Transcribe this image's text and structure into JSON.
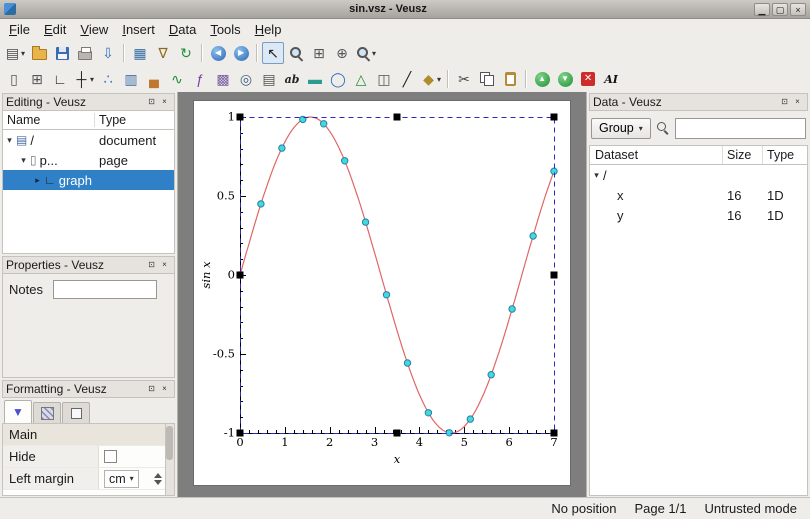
{
  "colors": {
    "accent": "#3080c8",
    "chrome": "#efedea",
    "canvas": "#7e7e7e"
  },
  "window": {
    "title": "sin.vsz - Veusz",
    "controls": {
      "minimize": "▁",
      "maximize": "▢",
      "close": "×"
    }
  },
  "panel_buttons": {
    "float": "⊡",
    "close": "×"
  },
  "menubar": {
    "items": [
      {
        "name": "menu-file",
        "label": "File"
      },
      {
        "name": "menu-edit",
        "label": "Edit"
      },
      {
        "name": "menu-view",
        "label": "View"
      },
      {
        "name": "menu-insert",
        "label": "Insert"
      },
      {
        "name": "menu-data",
        "label": "Data"
      },
      {
        "name": "menu-tools",
        "label": "Tools"
      },
      {
        "name": "menu-help",
        "label": "Help"
      }
    ]
  },
  "toolbar_main": {
    "items": [
      {
        "name": "new-document-button",
        "glyph": "▤",
        "color": "#4a4a4a",
        "dropdown": "▾"
      },
      {
        "name": "open-document-button",
        "cls": "folder"
      },
      {
        "name": "save-document-button",
        "cls": "floppy"
      },
      {
        "name": "print-button",
        "cls": "printer"
      },
      {
        "name": "export-button",
        "glyph": "⇩",
        "color": "#2f6fbc"
      },
      {
        "name": "separator",
        "sep": true
      },
      {
        "name": "edit-data-button",
        "glyph": "▦",
        "color": "#3a6ea5"
      },
      {
        "name": "filter-data-button",
        "glyph": "∇",
        "color": "#8a6d1f"
      },
      {
        "name": "reload-data-button",
        "glyph": "↻",
        "color": "#1f8f34"
      },
      {
        "name": "separator",
        "sep": true
      },
      {
        "name": "previous-page-button",
        "glyph": "◀",
        "cls": "navball"
      },
      {
        "name": "next-page-button",
        "glyph": "▶",
        "cls": "navball"
      },
      {
        "name": "separator",
        "sep": true
      },
      {
        "name": "select-items-button",
        "glyph": "↖",
        "color": "#222",
        "pressed": true
      },
      {
        "name": "zoom-graph-button",
        "cls": "magnify"
      },
      {
        "name": "zoom-axes-button",
        "glyph": "⊞",
        "color": "#555"
      },
      {
        "name": "recenter-graph-button",
        "glyph": "⊕",
        "color": "#555"
      },
      {
        "name": "zoom-menu-button",
        "cls": "magnify",
        "dropdown": "▾"
      }
    ]
  },
  "toolbar_insert": {
    "items": [
      {
        "name": "insert-page-button",
        "glyph": "▯",
        "color": "#555"
      },
      {
        "name": "insert-grid-button",
        "glyph": "⊞",
        "color": "#555"
      },
      {
        "name": "insert-graph-button",
        "glyph": "∟",
        "color": "#222"
      },
      {
        "name": "insert-axis-button",
        "glyph": "┼",
        "color": "#222",
        "dropdown": "▾"
      },
      {
        "name": "insert-xy-button",
        "glyph": "∴",
        "color": "#2f6fbc"
      },
      {
        "name": "insert-bar-button",
        "glyph": "▥",
        "color": "#3a6ea5"
      },
      {
        "name": "insert-histogram-button",
        "glyph": "▄",
        "color": "#c07830"
      },
      {
        "name": "insert-fit-button",
        "glyph": "∿",
        "color": "#1f8f34"
      },
      {
        "name": "insert-function-button",
        "glyph": "ƒ",
        "color": "#7a3fa0"
      },
      {
        "name": "insert-image-button",
        "glyph": "▩",
        "color": "#7a5fa0"
      },
      {
        "name": "insert-contour-button",
        "glyph": "◎",
        "color": "#406080"
      },
      {
        "name": "insert-key-button",
        "glyph": "▤",
        "color": "#555"
      },
      {
        "name": "insert-label-button",
        "glyph": "ab",
        "color": "#222",
        "small": true
      },
      {
        "name": "insert-colorbar-button",
        "glyph": "▬",
        "color": "#2a9d8f"
      },
      {
        "name": "insert-polar-button",
        "glyph": "◯",
        "color": "#2f6fbc"
      },
      {
        "name": "insert-ternary-button",
        "glyph": "△",
        "color": "#1f8f34"
      },
      {
        "name": "insert-3d-button",
        "glyph": "◫",
        "color": "#555"
      },
      {
        "name": "insert-line-button",
        "glyph": "╱",
        "color": "#222"
      },
      {
        "name": "insert-shape-button",
        "glyph": "◆",
        "color": "#b08d2a",
        "dropdown": "▾"
      },
      {
        "name": "separator",
        "sep": true
      },
      {
        "name": "cut-button",
        "glyph": "✂",
        "color": "#444"
      },
      {
        "name": "copy-button",
        "cls": "copyicon"
      },
      {
        "name": "paste-button",
        "cls": "pasteicon"
      },
      {
        "name": "separator",
        "sep": true
      },
      {
        "name": "move-up-button",
        "glyph": "▲",
        "cls": "greenball"
      },
      {
        "name": "move-down-button",
        "glyph": "▼",
        "cls": "greenball"
      },
      {
        "name": "delete-button",
        "glyph": "✕",
        "cls": "redbox"
      },
      {
        "name": "rename-button",
        "glyph": "AI",
        "color": "#111",
        "small": true
      }
    ]
  },
  "editing_panel": {
    "title": "Editing - Veusz",
    "columns": [
      "Name",
      "Type"
    ],
    "tree": [
      {
        "name": "tree-item-document",
        "expander": "▾",
        "icon": "▤",
        "icon_color": "#4a6ea5",
        "label": "/",
        "type": "document",
        "depth": 0
      },
      {
        "name": "tree-item-page",
        "expander": "▾",
        "icon": "▯",
        "icon_color": "#777",
        "label": "p...",
        "type": "page",
        "depth": 1
      },
      {
        "name": "tree-item-graph",
        "expander": "▸",
        "icon": "∟",
        "icon_color": "#222",
        "label": "graph",
        "type": "",
        "depth": 2,
        "selected": true
      }
    ]
  },
  "properties_panel": {
    "title": "Properties - Veusz",
    "fields": [
      {
        "label": "Notes",
        "value": ""
      }
    ]
  },
  "formatting_panel": {
    "title": "Formatting - Veusz",
    "tabs": [
      {
        "glyph": "▼"
      }
    ],
    "rows": [
      {
        "name": "formatting-row-main",
        "label": "Main",
        "is_header": true
      },
      {
        "name": "formatting-row-hide",
        "label": "Hide",
        "is_checkbox": true
      },
      {
        "name": "formatting-row-left-margin",
        "label": "Left margin",
        "is_unit": true,
        "value": "cm",
        "unit_arrow": "▾"
      }
    ]
  },
  "data_panel": {
    "title": "Data - Veusz",
    "group_label": "Group",
    "group_arrow": "▾",
    "search_value": "",
    "columns": [
      "Dataset",
      "Size",
      "Type"
    ],
    "rows": [
      {
        "name": "dataset-root",
        "expander": "▾",
        "label": "/",
        "size": "",
        "type": "",
        "depth": 0
      },
      {
        "name": "dataset-x",
        "expander": "",
        "label": "x",
        "size": "16",
        "type": "1D",
        "depth": 1
      },
      {
        "name": "dataset-y",
        "expander": "",
        "label": "y",
        "size": "16",
        "type": "1D",
        "depth": 1
      }
    ]
  },
  "statusbar": {
    "items": [
      {
        "name": "status-position",
        "label": "No position"
      },
      {
        "name": "status-page",
        "label": "Page 1/1"
      },
      {
        "name": "status-mode",
        "label": "Untrusted mode"
      }
    ]
  },
  "chart_data": {
    "type": "line",
    "title": "",
    "xlabel": "x",
    "ylabel": "sin x",
    "xlim": [
      0,
      7
    ],
    "ylim": [
      -1,
      1
    ],
    "x_ticks": [
      0,
      1,
      2,
      3,
      4,
      5,
      6,
      7
    ],
    "x_tick_labels": [
      "0",
      "1",
      "2",
      "3",
      "4",
      "5",
      "6",
      "7"
    ],
    "y_ticks": [
      -1,
      -0.5,
      0,
      0.5,
      1
    ],
    "y_tick_labels": [
      "-1",
      "-0.5",
      "0",
      "0.5",
      "1"
    ],
    "x_minor_step": 0.2,
    "y_minor_step": 0.1,
    "grid": false,
    "selected_widget": "graph",
    "selection_color": "#2a2ac0",
    "series": [
      {
        "name": "function",
        "type": "function",
        "function": "sin(x)",
        "color": "#e06666"
      },
      {
        "name": "xy-points",
        "type": "points",
        "marker": "circle",
        "marker_fill": "#41d9e0",
        "marker_edge": "#2a7f9e",
        "x": [
          0,
          0.467,
          0.933,
          1.4,
          1.867,
          2.333,
          2.8,
          3.267,
          3.733,
          4.2,
          4.667,
          5.133,
          5.6,
          6.067,
          6.533,
          7
        ],
        "y": [
          0,
          0.45,
          0.803,
          0.985,
          0.957,
          0.723,
          0.335,
          -0.125,
          -0.557,
          -0.872,
          -0.999,
          -0.912,
          -0.631,
          -0.215,
          0.247,
          0.657
        ]
      }
    ]
  }
}
